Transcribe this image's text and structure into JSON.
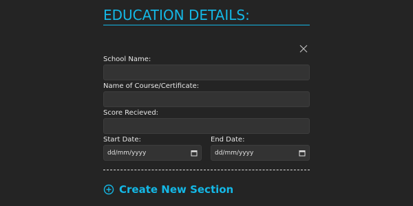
{
  "section": {
    "title": "EDUCATION DETAILS:",
    "accent_color": "#14b8e6",
    "close_icon": "close-icon"
  },
  "form": {
    "school_name": {
      "label": "School Name:",
      "value": ""
    },
    "course": {
      "label": "Name of Course/Certificate:",
      "value": ""
    },
    "score": {
      "label": "Score Recieved:",
      "value": ""
    },
    "start_date": {
      "label": "Start Date:",
      "placeholder": "dd/mm/yyyy"
    },
    "end_date": {
      "label": "End Date:",
      "placeholder": "dd/mm/yyyy"
    }
  },
  "actions": {
    "create_label": "Create New Section",
    "create_icon": "plus-circle-icon"
  }
}
